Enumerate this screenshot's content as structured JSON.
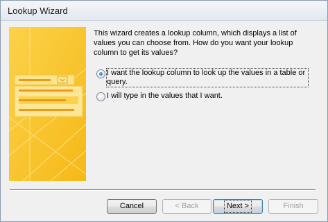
{
  "window": {
    "title": "Lookup Wizard"
  },
  "description": "This wizard creates a lookup column, which displays a list of values you can choose from.  How do you want your lookup column to get its values?",
  "options": [
    {
      "label": "I want the lookup column to look up the values in a table or query.",
      "checked": true
    },
    {
      "label": "I will type in the values that I want.",
      "checked": false
    }
  ],
  "buttons": {
    "cancel": "Cancel",
    "back": "< Back",
    "next": "Next >",
    "finish": "Finish"
  },
  "colors": {
    "illustration_bg": "#f9c62e",
    "default_button_border": "#3c7fb1"
  }
}
